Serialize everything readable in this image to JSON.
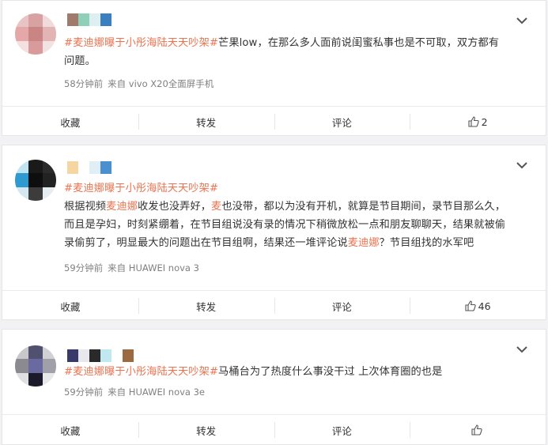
{
  "posts": [
    {
      "topic": "#麦迪娜曝于小彤海陆天天吵架#",
      "text_parts": [
        "芒果low，在那么多人面前说闺蜜私事也是不可取，双方都有",
        "问题。"
      ],
      "time": "58分钟前",
      "source": "来自 vivo X20全面屏手机",
      "actions": {
        "collect": "收藏",
        "forward": "转发",
        "comment": "评论",
        "like_count": "2"
      }
    },
    {
      "topic": "#麦迪娜曝于小彤海陆天天吵架#",
      "line1_a": "根据视频",
      "line1_mention": "麦迪娜",
      "line1_b": "收发也没弄好，",
      "line1_mention2": "麦",
      "line1_c": "也没带，都以为没有开机，就算是节目期间，录节目那么久，",
      "line2": "而且是孕妇，时刻紧绷着，在节目组说没有录的情况下稍微放松一点和朋友聊聊天，结果就被偷",
      "line3_a": "录偷剪了，明显最大的问题出在节目组啊，结果还一堆评论说",
      "line3_mention": "麦迪娜",
      "line3_b": "？节目组找的水军吧",
      "time": "59分钟前",
      "source": "来自 HUAWEI nova 3",
      "actions": {
        "collect": "收藏",
        "forward": "转发",
        "comment": "评论",
        "like_count": "46"
      }
    },
    {
      "topic": "#麦迪娜曝于小彤海陆天天吵架#",
      "text": "马桶台为了热度什么事没干过 上次体育圈的也是",
      "time": "59分钟前",
      "source": "来自 HUAWEI nova 3e",
      "actions": {
        "collect": "收藏",
        "forward": "转发",
        "comment": "评论",
        "like_count": ""
      }
    }
  ],
  "icons": {
    "chevron": "chevron-down-icon",
    "like": "thumbs-up-icon"
  },
  "colors": {
    "accent": "#eb7350",
    "meta": "#808080",
    "bg": "#f2f2f5"
  }
}
